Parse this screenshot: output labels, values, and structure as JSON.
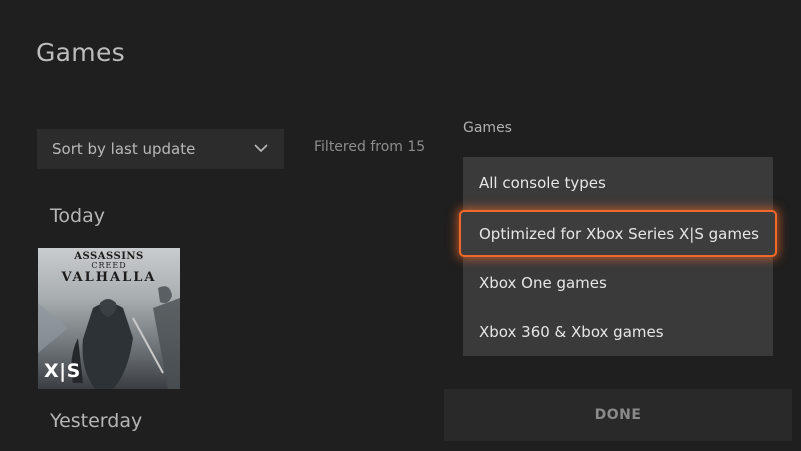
{
  "page": {
    "title": "Games"
  },
  "sort": {
    "label": "Sort by last update"
  },
  "filter_note": "Filtered from 15",
  "sections": {
    "today": "Today",
    "yesterday": "Yesterday"
  },
  "tile": {
    "title_line1": "ASSASSINS",
    "title_line2": "CREED",
    "title_line3": "VALHALLA",
    "badge": "X|S"
  },
  "panel": {
    "label": "Games",
    "options": [
      "All console types",
      "Optimized for Xbox Series X|S games",
      "Xbox One games",
      "Xbox 360 & Xbox games"
    ],
    "selected_index": 1,
    "done_label": "DONE"
  },
  "colors": {
    "background": "#1f1f1f",
    "focus": "#f0682a"
  }
}
